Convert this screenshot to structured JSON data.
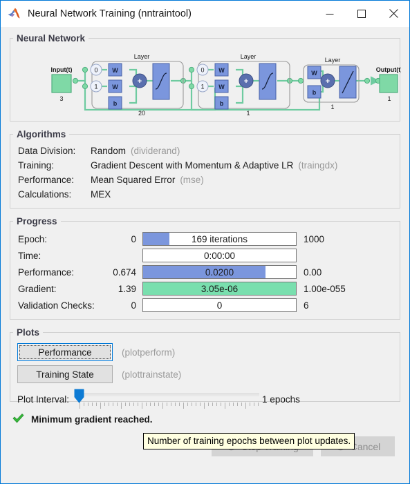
{
  "window": {
    "title": "Neural Network Training (nntraintool)",
    "app_icon": "matlab-logo-icon",
    "minimize_label": "Minimize",
    "maximize_label": "Maximize",
    "close_label": "Close"
  },
  "neural_network": {
    "legend": "Neural Network",
    "input_label": "Input(t)",
    "input_size": "3",
    "output_label": "Output(t)",
    "output_size": "1",
    "layers": [
      {
        "title": "Layer",
        "size": "20",
        "delays": [
          "0",
          "1"
        ],
        "weight": "W",
        "bias": "b",
        "sum": "+",
        "transfer": "tansig"
      },
      {
        "title": "Layer",
        "size": "1",
        "delays": [
          "0",
          "1"
        ],
        "weight": "W",
        "bias": "b",
        "sum": "+",
        "transfer": "tansig"
      },
      {
        "title": "Layer",
        "size": "1",
        "delays": [],
        "weight": "W",
        "bias": "b",
        "sum": "+",
        "transfer": "purelin"
      }
    ]
  },
  "algorithms": {
    "legend": "Algorithms",
    "rows": [
      {
        "label": "Data Division:",
        "value": "Random",
        "fn": "(dividerand)"
      },
      {
        "label": "Training:",
        "value": "Gradient Descent with Momentum & Adaptive LR",
        "fn": "(traingdx)"
      },
      {
        "label": "Performance:",
        "value": "Mean Squared Error",
        "fn": "(mse)"
      },
      {
        "label": "Calculations:",
        "value": "MEX",
        "fn": ""
      }
    ]
  },
  "progress": {
    "legend": "Progress",
    "rows": [
      {
        "label": "Epoch:",
        "left": "0",
        "bar_text": "169 iterations",
        "right": "1000",
        "fill_percent": 17,
        "fill_color": "blue"
      },
      {
        "label": "Time:",
        "left": "",
        "bar_text": "0:00:00",
        "right": "",
        "fill_percent": 0,
        "fill_color": "blue"
      },
      {
        "label": "Performance:",
        "left": "0.674",
        "bar_text": "0.0200",
        "right": "0.00",
        "fill_percent": 80,
        "fill_color": "blue"
      },
      {
        "label": "Gradient:",
        "left": "1.39",
        "bar_text": "3.05e-06",
        "right": "1.00e-055",
        "fill_percent": 100,
        "fill_color": "green"
      },
      {
        "label": "Validation Checks:",
        "left": "0",
        "bar_text": "0",
        "right": "6",
        "fill_percent": 0,
        "fill_color": "blue"
      }
    ]
  },
  "plots": {
    "legend": "Plots",
    "buttons": [
      {
        "label": "Performance",
        "fn": "(plotperform)",
        "focused": true
      },
      {
        "label": "Training State",
        "fn": "(plottrainstate)",
        "focused": false
      }
    ],
    "interval_label": "Plot Interval:",
    "interval_value": "1 epochs",
    "tooltip": "Number of training epochs between plot updates."
  },
  "status": {
    "icon": "green-check-icon",
    "message": "Minimum gradient reached."
  },
  "footer": {
    "stop_label": "Stop Training",
    "stop_icon": "stop-sign-icon",
    "cancel_label": "Cancel",
    "cancel_icon": "cancel-circle-icon"
  },
  "colors": {
    "accent": "#0078d7",
    "bar_blue": "#7b96dd",
    "bar_green": "#79dfae",
    "node_green": "#7fd9a6",
    "node_blue": "#7b96dd",
    "tooltip_bg": "#ffffe1"
  }
}
